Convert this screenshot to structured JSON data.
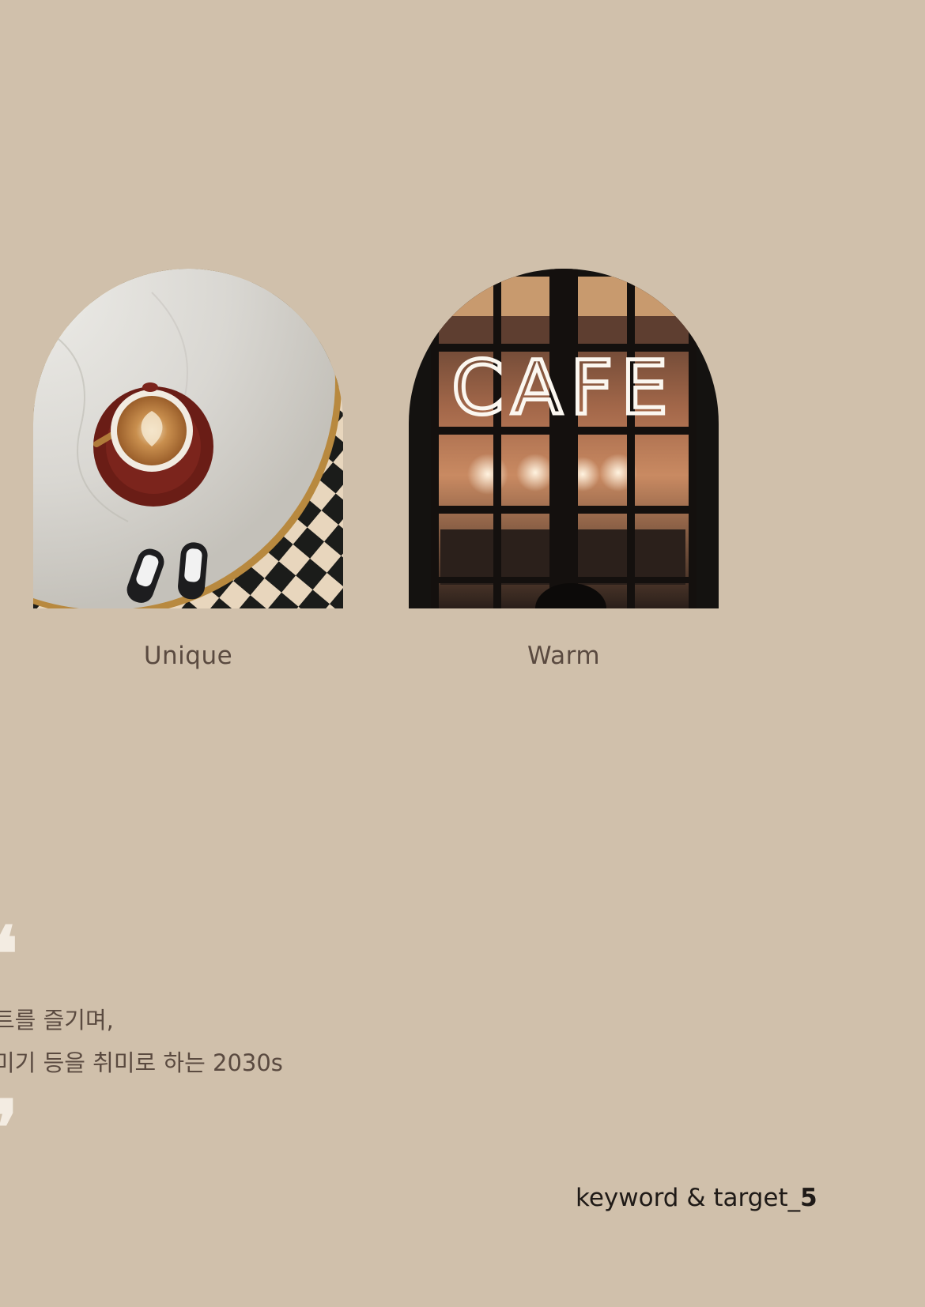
{
  "cards": [
    {
      "caption": "Unique",
      "image": "latte-on-marble-table-with-checkered-floor"
    },
    {
      "caption": "Warm",
      "image": "cafe-neon-sign-window"
    }
  ],
  "neon_sign": "CAFE",
  "quote": {
    "open_mark": "❛",
    "line1": "트를 즐기며,",
    "line2": "미기 등을 취미로 하는 2030s",
    "close_mark": "❜"
  },
  "footer": {
    "label": "keyword & target_",
    "page_number": "5"
  },
  "colors": {
    "background": "#d0c0ab",
    "caption_text": "#5a4a40",
    "quote_mark": "#f3ece2",
    "footer_text": "#1f1a17"
  }
}
